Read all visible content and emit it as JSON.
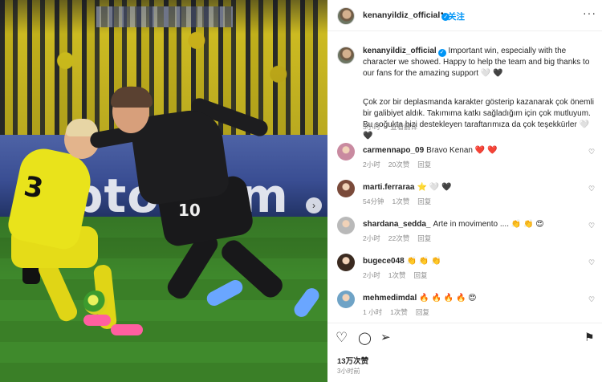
{
  "photo": {
    "board_text": "ypto.com",
    "player1_number": "3",
    "player2_number": "10",
    "next_arrow": "›"
  },
  "header": {
    "username": "kenanyildiz_official",
    "verified_glyph": "✓",
    "dot": "•",
    "follow_label": "关注",
    "more_glyph": "···"
  },
  "caption": {
    "username": "kenanyildiz_official",
    "text_en": "Important win, especially with the character we showed. Happy to help the team and big thanks to our fans for the amazing support 🤍 🖤",
    "text_tr": "Çok zor bir deplasmanda karakter gösterip kazanarak çok önemli bir galibiyet aldık. Takımıma katkı sağladığım için çok mutluyum. Bu soğukta bizi destekleyen taraftarımıza da çok teşekkürler 🤍 🖤",
    "time": "3小时",
    "translate": "查看翻译"
  },
  "comments": [
    {
      "username": "carmennapo_09",
      "text": "Bravo Kenan ❤️ ❤️",
      "time": "2小时",
      "likes": "20次赞",
      "reply": "回复",
      "avatar_color": "#c98aa0"
    },
    {
      "username": "marti.ferraraa",
      "text": "⭐ 🤍 🖤",
      "time": "54分钟",
      "likes": "1次赞",
      "reply": "回复",
      "avatar_color": "#7a4a3a"
    },
    {
      "username": "shardana_sedda_",
      "text": "Arte in movimento .... 👏 👏 😍",
      "time": "2小时",
      "likes": "22次赞",
      "reply": "回复",
      "avatar_color": "#b9b9b9"
    },
    {
      "username": "bugece048",
      "text": "👏 👏 👏",
      "time": "2小时",
      "likes": "1次赞",
      "reply": "回复",
      "avatar_color": "#3a2a20"
    },
    {
      "username": "mehmedimdal",
      "text": "🔥 🔥 🔥 🔥 😍",
      "time": "1 小时",
      "likes": "1次赞",
      "reply": "回复",
      "avatar_color": "#6fa3c6"
    }
  ],
  "actions": {
    "like_glyph": "♡",
    "comment_glyph": "◯",
    "share_glyph": "➢",
    "save_glyph": "⚑"
  },
  "likes": "13万次赞",
  "posted": "3小时前",
  "heart_glyph": "♡"
}
